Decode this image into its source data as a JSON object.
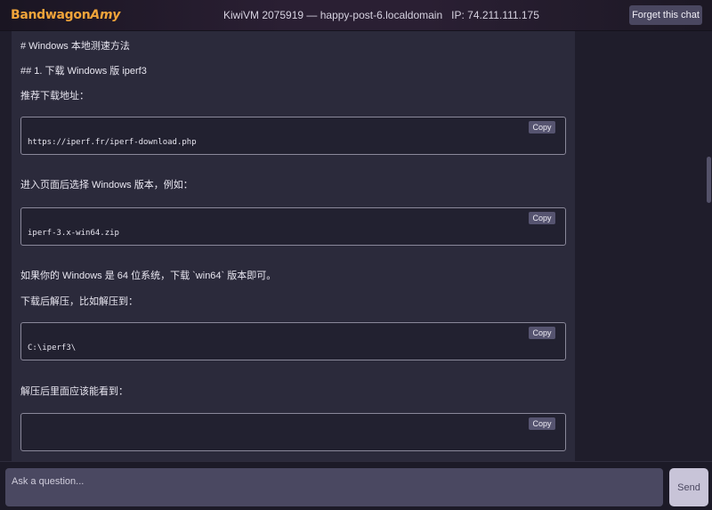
{
  "app": {
    "logo_part1": "Bandwagon",
    "logo_part2": "Amy"
  },
  "header": {
    "vm_name": "KiwiVM 2075919 — happy-post-6.localdomain",
    "ip": "IP: 74.211.111.175",
    "forget_button": "Forget this chat"
  },
  "message": {
    "h1": "# Windows 本地测速方法",
    "h2": "## 1. 下载 Windows 版 iperf3",
    "p1": "推荐下载地址：",
    "code1": "https://iperf.fr/iperf-download.php",
    "p2": "进入页面后选择 Windows 版本，例如：",
    "code2": "iperf-3.x-win64.zip",
    "p3": "如果你的 Windows 是 64 位系统，下载 `win64` 版本即可。",
    "p4": "下载后解压，比如解压到：",
    "code3": "C:\\iperf3\\",
    "p5": "解压后里面应该能看到：",
    "code4": "",
    "copy_label": "Copy"
  },
  "composer": {
    "placeholder": "Ask a question...",
    "send_label": "Send"
  },
  "colors": {
    "accent": "#f0a43a",
    "background": "#1f1d2b",
    "chat_bg": "#2b2a3b"
  }
}
